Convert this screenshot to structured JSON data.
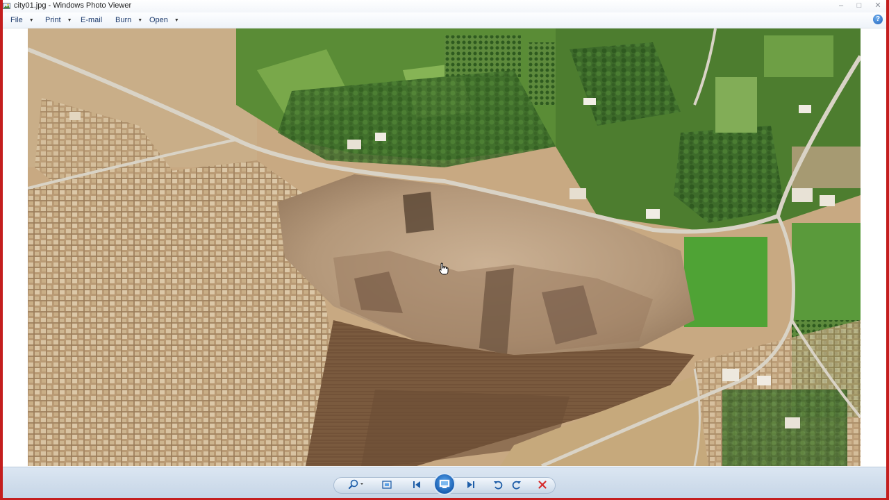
{
  "window": {
    "title": "city01.jpg - Windows Photo Viewer",
    "controls": {
      "minimize": "–",
      "maximize": "□",
      "close": "✕"
    }
  },
  "menu": {
    "items": [
      {
        "label": "File",
        "has_dropdown": true
      },
      {
        "label": "Print",
        "has_dropdown": true
      },
      {
        "label": "E-mail",
        "has_dropdown": false
      },
      {
        "label": "Burn",
        "has_dropdown": true
      },
      {
        "label": "Open",
        "has_dropdown": true
      }
    ],
    "help": "?"
  },
  "toolbar": {
    "buttons": [
      {
        "icon": "zoom-icon"
      },
      {
        "icon": "actual-size-icon"
      },
      {
        "icon": "previous-icon"
      },
      {
        "icon": "slideshow-icon"
      },
      {
        "icon": "next-icon"
      },
      {
        "icon": "rotate-counterclockwise-icon"
      },
      {
        "icon": "rotate-clockwise-icon"
      },
      {
        "icon": "delete-icon"
      }
    ],
    "delete_color": "#d62b2b",
    "accent_color": "#1f6fc4"
  },
  "photo": {
    "description_icon": "aerial-photo"
  }
}
